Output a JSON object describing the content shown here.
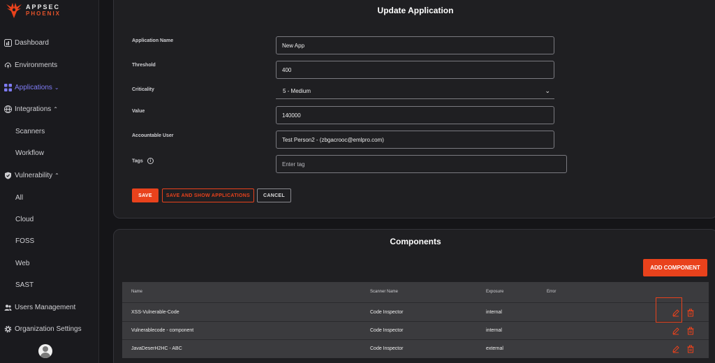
{
  "brand": {
    "line1": "APPSEC",
    "line2": "PHOENIX",
    "accent": "#e9421c"
  },
  "sidebar": {
    "items": [
      {
        "label": "Dashboard",
        "icon": "chart-icon"
      },
      {
        "label": "Environments",
        "icon": "cloud-upload-icon"
      },
      {
        "label": "Applications",
        "icon": "grid-icon",
        "active": true
      },
      {
        "label": "Integrations",
        "icon": "globe-icon"
      },
      {
        "label": "Scanners"
      },
      {
        "label": "Workflow"
      },
      {
        "label": "Vulnerability",
        "icon": "shield-icon"
      },
      {
        "label": "All"
      },
      {
        "label": "Cloud"
      },
      {
        "label": "FOSS"
      },
      {
        "label": "Web"
      },
      {
        "label": "SAST"
      },
      {
        "label": "Users Management",
        "icon": "users-icon"
      },
      {
        "label": "Organization Settings",
        "icon": "gear-icon"
      }
    ]
  },
  "update": {
    "title": "Update Application",
    "fields": {
      "name_label": "Application Name",
      "name_value": "New App",
      "threshold_label": "Threshold",
      "threshold_value": "400",
      "criticality_label": "Criticality",
      "criticality_value": "5 - Medium",
      "value_label": "Value",
      "value_value": "140000",
      "user_label": "Accountable User",
      "user_value": "Test Person2 - (zbgacrooc@emlpro.com)",
      "tags_label": "Tags",
      "tags_placeholder": "Enter tag"
    },
    "buttons": {
      "save": "SAVE",
      "save_show": "SAVE AND SHOW APPLICATIONS",
      "cancel": "CANCEL"
    }
  },
  "components": {
    "title": "Components",
    "add_label": "ADD COMPONENT",
    "columns": [
      "Name",
      "Scanner Name",
      "Exposure",
      "Error"
    ],
    "rows": [
      {
        "name": "XSS-Vulnerable-Code",
        "scanner": "Code Inspector",
        "exposure": "internal",
        "error": ""
      },
      {
        "name": "Vulnerablecode - component",
        "scanner": "Code Inspector",
        "exposure": "internal",
        "error": ""
      },
      {
        "name": "JavaDeserH2HC - ABC",
        "scanner": "Code Inspector",
        "exposure": "external",
        "error": ""
      }
    ]
  }
}
